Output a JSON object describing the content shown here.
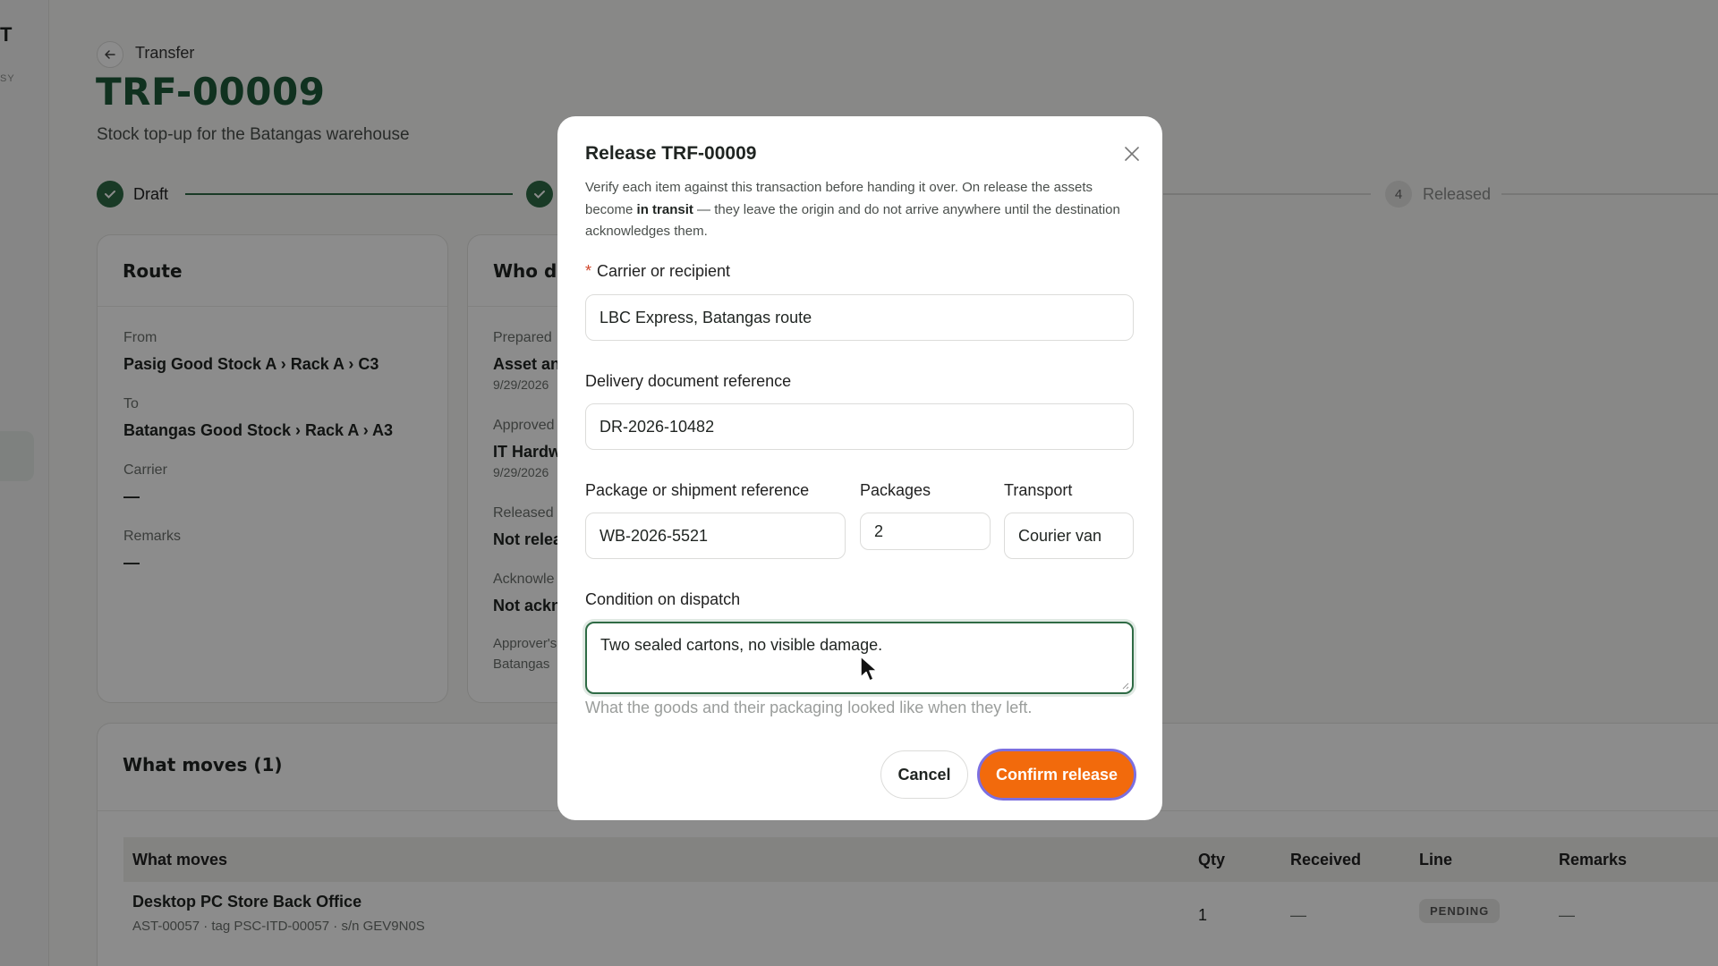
{
  "sidebar": {
    "logo": "T",
    "subtitle": "SY"
  },
  "header": {
    "breadcrumb": "Transfer",
    "title": "TRF-00009",
    "subtitle": "Stock top-up for the Batangas warehouse"
  },
  "stepper": {
    "step1": {
      "label": "Draft",
      "state": "complete"
    },
    "step4": {
      "number": "4",
      "label": "Released"
    }
  },
  "route": {
    "title": "Route",
    "from_label": "From",
    "from_value": "Pasig Good Stock A › Rack A › C3",
    "to_label": "To",
    "to_value": "Batangas Good Stock › Rack A › A3",
    "carrier_label": "Carrier",
    "carrier_value": "—",
    "remarks_label": "Remarks",
    "remarks_value": "—"
  },
  "who": {
    "title": "Who d",
    "prepared_label": "Prepared",
    "prepared_value": "Asset an",
    "prepared_date": "9/29/2026",
    "approved_label": "Approved",
    "approved_value": "IT Hardw",
    "approved_date": "9/29/2026",
    "released_label": "Released",
    "released_value": "Not relea",
    "ack_label": "Acknowle",
    "ack_value": "Not ackn",
    "approver_label": "Approver's",
    "approver_value": "Batangas"
  },
  "moves": {
    "title": "What moves (1)",
    "columns": [
      "What moves",
      "Qty",
      "Received",
      "Line",
      "Remarks"
    ],
    "rows": [
      {
        "name": "Desktop PC Store Back Office",
        "sub": "AST-00057 · tag PSC-ITD-00057 · s/n GEV9N0S",
        "qty": "1",
        "received": "—",
        "line": "PENDING",
        "remarks": "—"
      }
    ]
  },
  "modal": {
    "title": "Release TRF-00009",
    "desc_pre": "Verify each item against this transaction before handing it over. On release the assets become ",
    "desc_bold": "in transit",
    "desc_post": " — they leave the origin and do not arrive anywhere until the destination acknowledges them.",
    "carrier_label": "Carrier or recipient",
    "carrier_required": "*",
    "carrier_value": "LBC Express, Batangas route",
    "doc_label": "Delivery document reference",
    "doc_value": "DR-2026-10482",
    "package_label": "Package or shipment reference",
    "package_value": "WB-2026-5521",
    "packages_label": "Packages",
    "packages_value": "2",
    "transport_label": "Transport",
    "transport_value": "Courier van",
    "condition_label": "Condition on dispatch",
    "condition_value": "Two sealed cartons, no visible damage.",
    "condition_help": "What the goods and their packaging looked like when they left.",
    "cancel_label": "Cancel",
    "confirm_label": "Confirm release"
  },
  "colors": {
    "brand_green": "#1e5a3a",
    "accent_orange": "#f26a0c",
    "focus_ring": "#7c6fe0"
  }
}
